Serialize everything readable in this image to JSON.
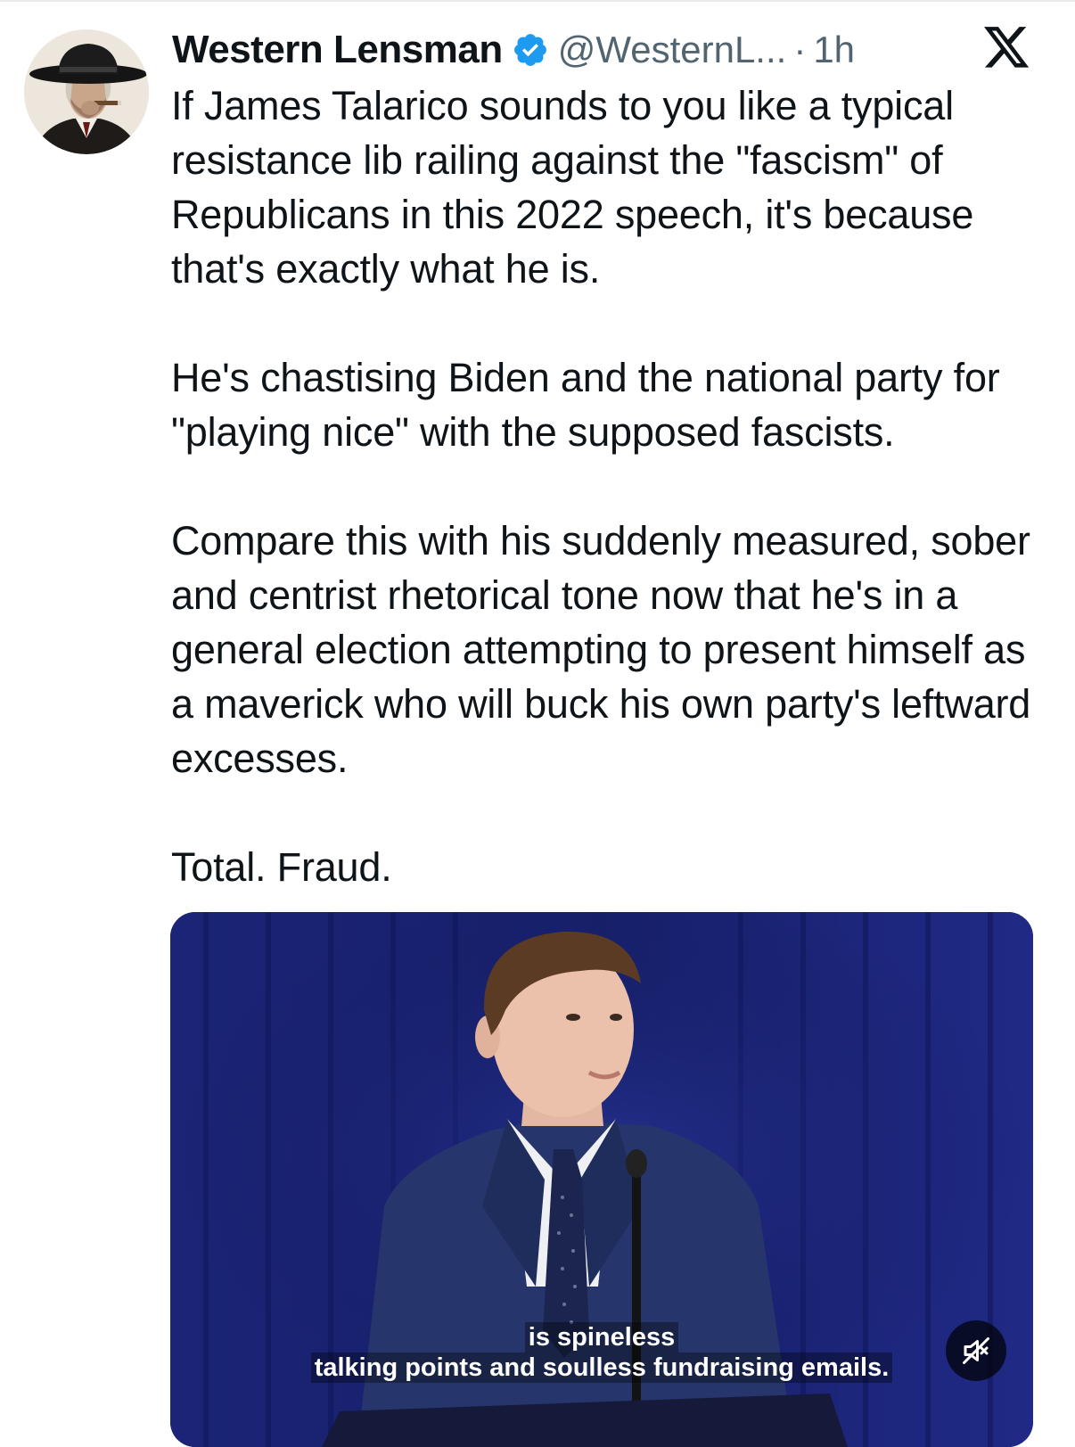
{
  "author": {
    "display_name": "Western Lensman",
    "handle": "@WesternL...",
    "separator": "·",
    "time": "1h",
    "avatar_icon": "cowboy-portrait-avatar",
    "verified_icon": "verified-badge-icon",
    "verified_color": "#1d9bf0"
  },
  "platform_icon": "x-logo-icon",
  "tweet": {
    "paragraphs": [
      "If James Talarico sounds to you like a typical resistance lib railing against the \"fascism\" of Republicans in this 2022 speech, it's because that's exactly what he is.",
      "He's chastising Biden and the national party for \"playing nice\" with the supposed fascists.",
      "Compare this with his suddenly measured, sober and centrist rhetorical tone now that he's in a general election attempting to present himself as a maverick who will buck his own party's leftward excesses.",
      "Total. Fraud."
    ]
  },
  "media": {
    "type": "video",
    "caption_line_1": "is spineless",
    "caption_line_2": "talking points and soulless fundraising emails.",
    "mute_icon": "speaker-muted-icon",
    "background_color": "#1a1f6e"
  },
  "colors": {
    "text": "#0f1419",
    "secondary_text": "#536471",
    "accent": "#1d9bf0"
  }
}
